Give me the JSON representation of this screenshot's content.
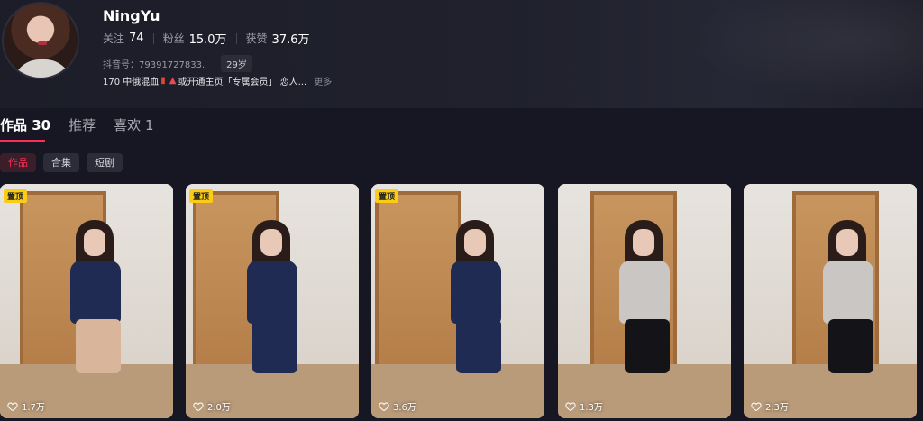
{
  "profile": {
    "name": "NingYu",
    "stats": [
      {
        "label": "关注",
        "value": "74"
      },
      {
        "label": "粉丝",
        "value": "15.0万"
      },
      {
        "label": "获赞",
        "value": "37.6万"
      }
    ],
    "douyin_id": "抖音号：79391727833.",
    "age": "29岁",
    "bio_prefix": "170 中俄混血",
    "bio_text": "或开通主页「专属会员」 恋人...",
    "more": "更多"
  },
  "tabs": [
    {
      "label": "作品",
      "count": "30",
      "active": true
    },
    {
      "label": "推荐",
      "count": "",
      "active": false
    },
    {
      "label": "喜欢",
      "count": "1",
      "active": false
    }
  ],
  "chips": [
    "作品",
    "合集",
    "短剧"
  ],
  "videos": [
    {
      "pinned": "置顶",
      "likes": "1.7万",
      "outfit": "navy",
      "legs": "nude"
    },
    {
      "pinned": "置顶",
      "likes": "2.0万",
      "outfit": "navy",
      "legs": "navy"
    },
    {
      "pinned": "置顶",
      "likes": "3.6万",
      "outfit": "navy",
      "legs": "navy"
    },
    {
      "pinned": "",
      "likes": "1.3万",
      "outfit": "gray",
      "legs": "black"
    },
    {
      "pinned": "",
      "likes": "2.3万",
      "outfit": "gray",
      "legs": "black"
    }
  ],
  "colors": {
    "accent": "#fe2c55",
    "pin": "#facc15",
    "background": "#161722"
  }
}
